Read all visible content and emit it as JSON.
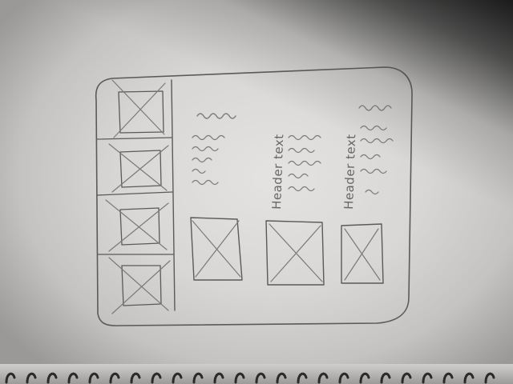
{
  "sketch": {
    "cards": [
      {
        "header": ""
      },
      {
        "header": "Header text"
      },
      {
        "header": "Header text"
      }
    ],
    "gallery_thumbnails": 4
  }
}
